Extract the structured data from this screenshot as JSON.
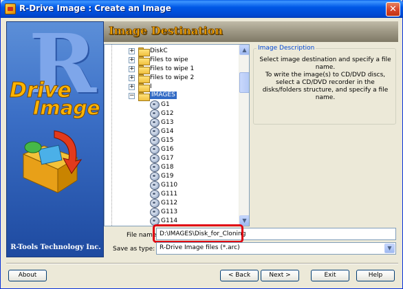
{
  "window": {
    "title": "R-Drive Image : Create an Image",
    "close_glyph": "✕"
  },
  "sidebar": {
    "logo_letter": "R",
    "logo_word1": "Drive",
    "logo_word2": "Image",
    "footer": "R-Tools Technology Inc."
  },
  "header": {
    "title": "Image Destination"
  },
  "tree": {
    "folders": [
      {
        "label": "DiskC",
        "expander": "+"
      },
      {
        "label": "Files to wipe",
        "expander": "+"
      },
      {
        "label": "Files to wipe 1",
        "expander": "+"
      },
      {
        "label": "Files to wipe 2",
        "expander": "+"
      },
      {
        "label": "I",
        "expander": "+"
      },
      {
        "label": "IMAGES",
        "expander": "−"
      }
    ],
    "images": [
      "G1",
      "G12",
      "G13",
      "G14",
      "G15",
      "G16",
      "G17",
      "G18",
      "G19",
      "G110",
      "G111",
      "G112",
      "G113",
      "G114"
    ],
    "scroll_up": "▲",
    "scroll_down": "▼"
  },
  "description": {
    "legend": "Image Description",
    "line1": "Select image destination and specify a file name.",
    "line2": "To write the image(s) to CD/DVD discs, select a CD/DVD recorder in the disks/folders structure, and specify a file name."
  },
  "file_name": {
    "label": "File name:",
    "value": "D:\\IMAGES\\Disk_for_Cloning"
  },
  "save_as": {
    "label": "Save as type:",
    "value": "R-Drive Image files (*.arc)",
    "arrow": "▼"
  },
  "buttons": {
    "about": "About",
    "back": "< Back",
    "next": "Next >",
    "exit": "Exit",
    "help": "Help"
  },
  "colors": {
    "title_bar": "#0058e6",
    "highlight": "#e00010",
    "selected": "#316ac5",
    "header_text": "#f0a000"
  }
}
